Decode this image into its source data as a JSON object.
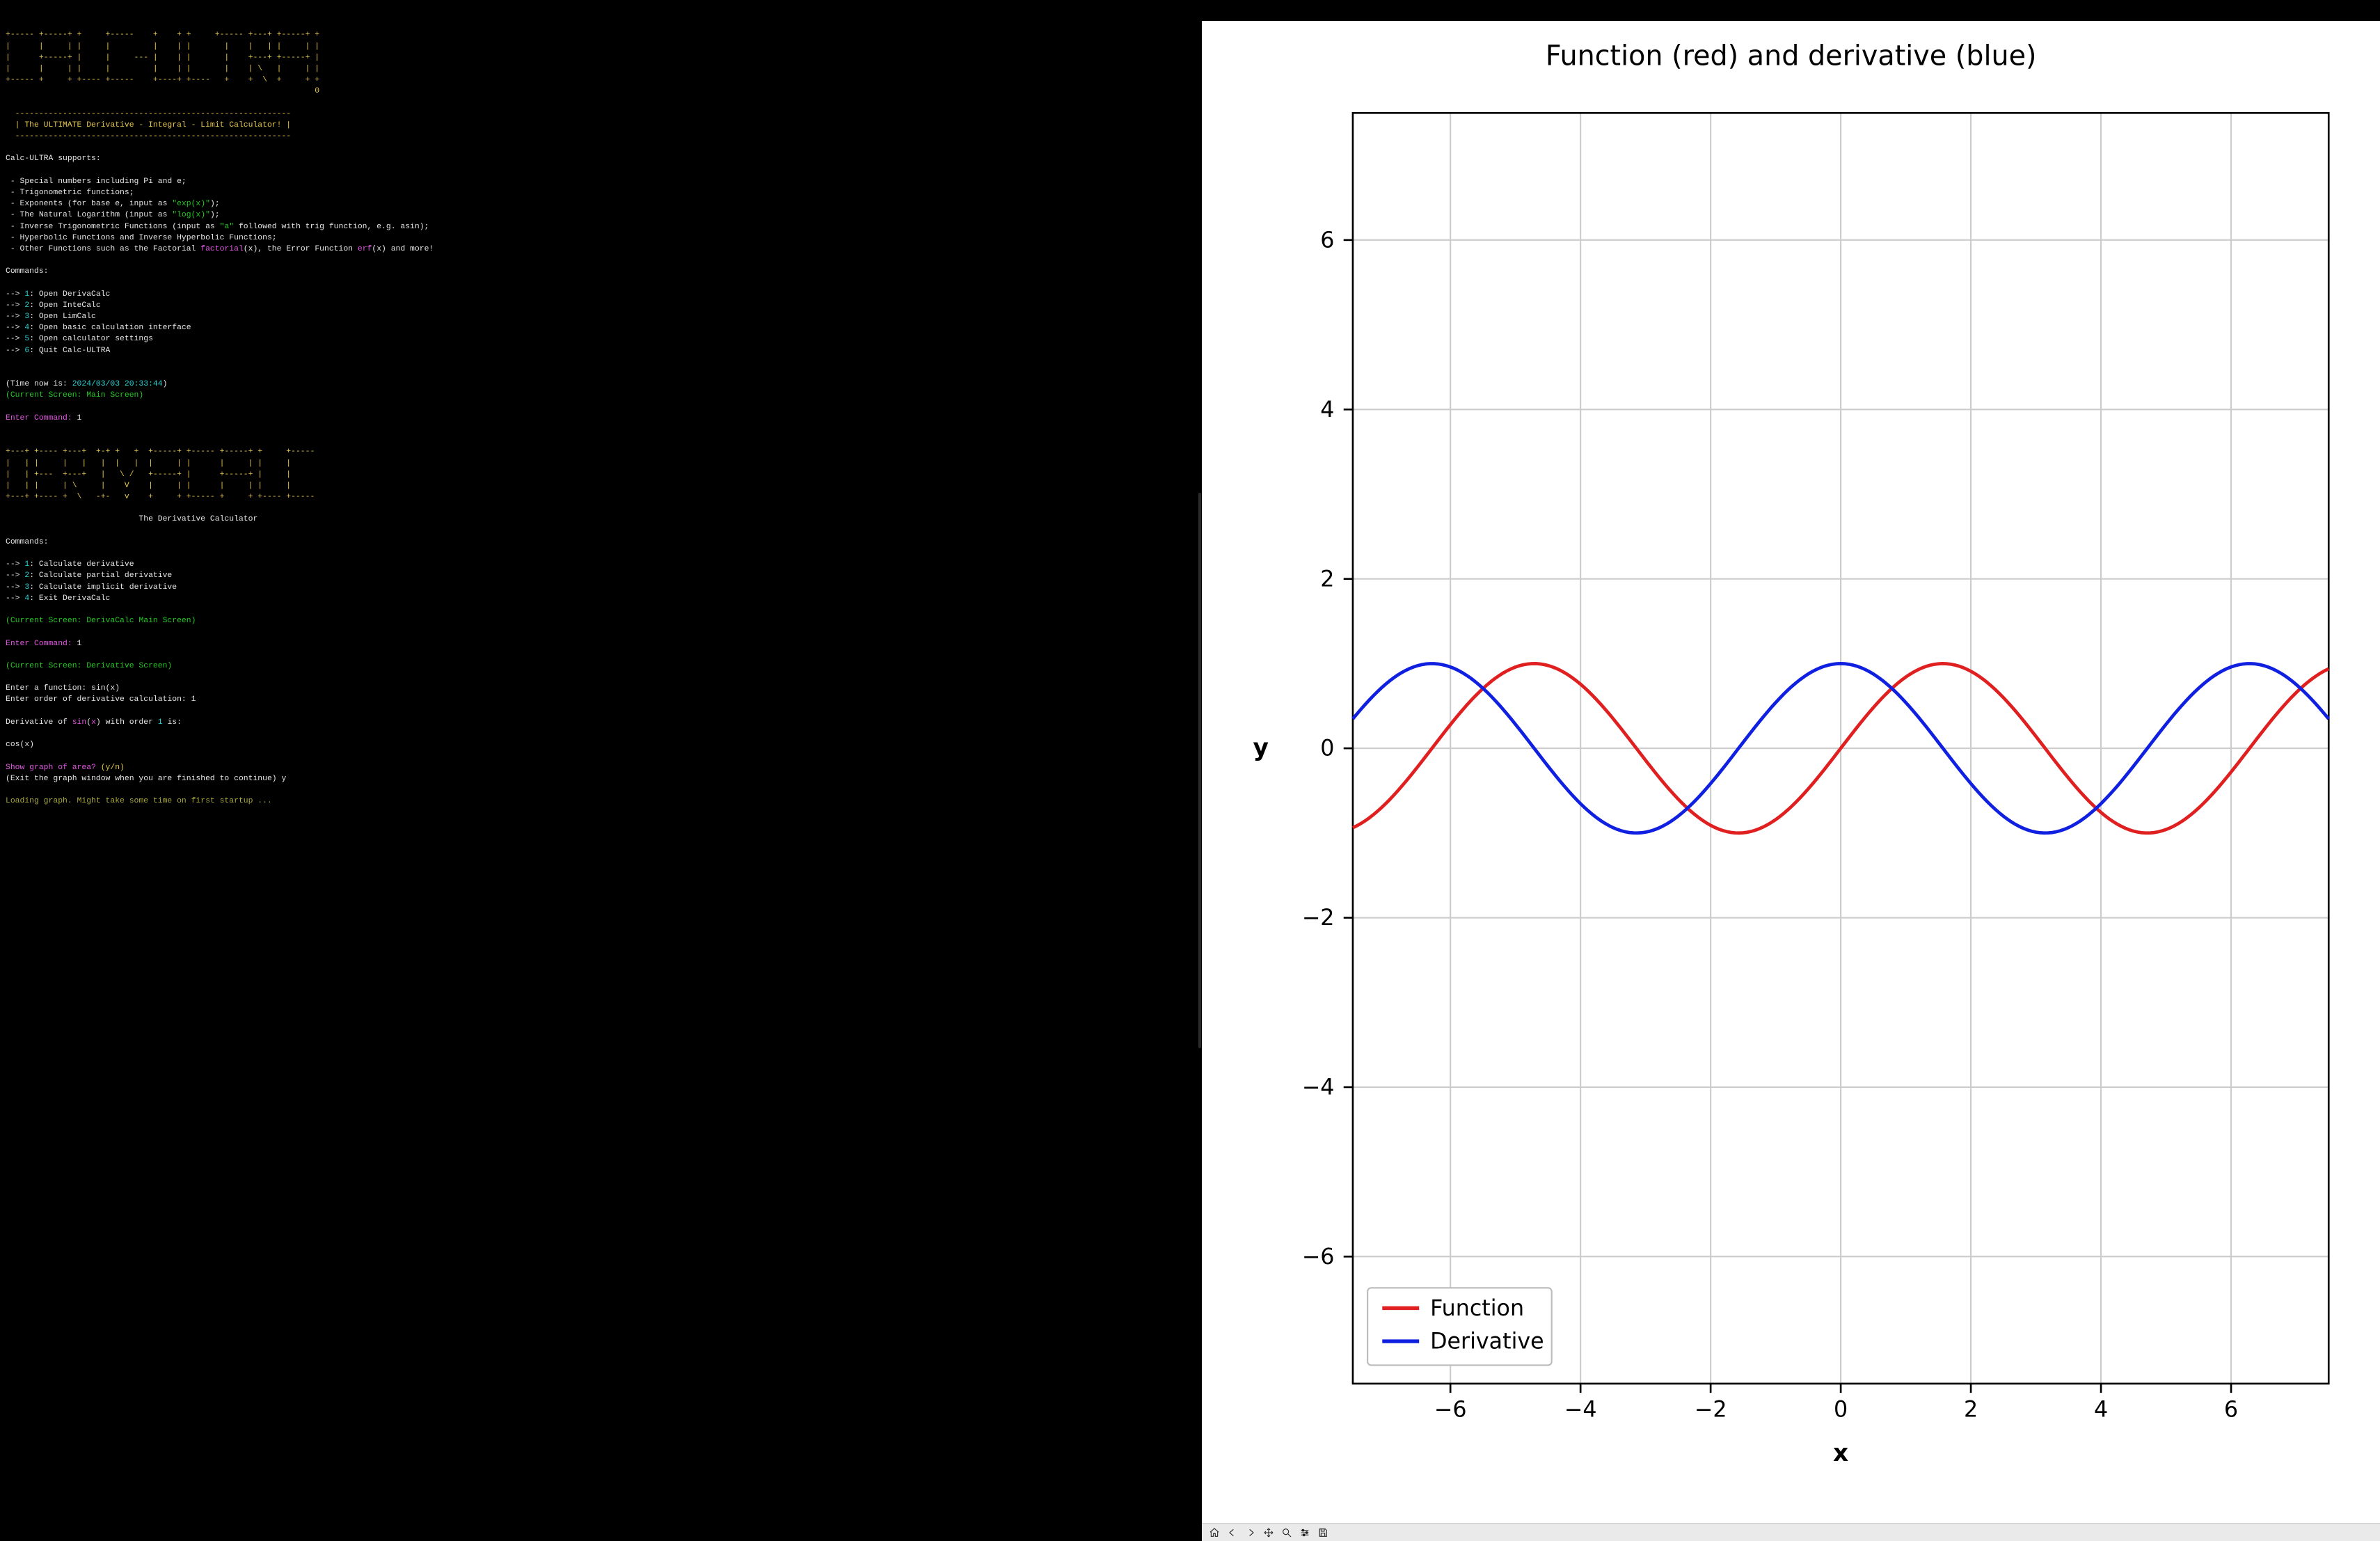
{
  "terminal": {
    "calc_ultra_banner": [
      "+----- +-----+ +     +-----    +    + +     +----- +---+ +-----+ +",
      "|      |     | |     |         |    | |       |    |   | |     | |",
      "|      +-----+ |     |     --- |    | |       |    +---+ +-----+ |",
      "|      |     | |     |         |    | |       |    | \\   |     | |",
      "+----- +     + +---- +-----    +----+ +----   +    +  \\  +     + +",
      "                                                                 0"
    ],
    "banner_divider_top": "  ----------------------------------------------------------",
    "banner_tagline": "  | The ULTIMATE Derivative - Integral - Limit Calculator! |",
    "banner_divider_bottom": "  ----------------------------------------------------------",
    "supports_heading": "Calc-ULTRA supports:",
    "supports": {
      "line1": " - Special numbers including Pi and e;",
      "line2": " - Trigonometric functions;",
      "line3_a": " - Exponents (for base e, input as ",
      "line3_b": "\"exp(x)\"",
      "line3_c": ");",
      "line4_a": " - The Natural Logarithm (input as ",
      "line4_b": "\"log(x)\"",
      "line4_c": ");",
      "line5_a": " - Inverse Trigonometric Functions (input as ",
      "line5_b": "\"a\"",
      "line5_c": " followed with trig function, e.g. asin);",
      "line6": " - Hyperbolic Functions and Inverse Hyperbolic Functions;",
      "line7_a": " - Other Functions such as the Factorial ",
      "line7_b": "factorial",
      "line7_c": "(x), the Error Function ",
      "line7_d": "erf",
      "line7_e": "(x) and more!"
    },
    "commands_heading": "Commands:",
    "commands": [
      {
        "num": "1",
        "label": "Open DerivaCalc"
      },
      {
        "num": "2",
        "label": "Open InteCalc"
      },
      {
        "num": "3",
        "label": "Open LimCalc"
      },
      {
        "num": "4",
        "label": "Open basic calculation interface"
      },
      {
        "num": "5",
        "label": "Open calculator settings"
      },
      {
        "num": "6",
        "label": "Quit Calc-ULTRA"
      }
    ],
    "time_prefix": "(Time now is: ",
    "time_value": "2024/03/03 20:33:44",
    "time_suffix": ")",
    "current_screen_main": "(Current Screen: Main Screen)",
    "enter_command_label": "Enter Command:",
    "enter_command_value_1": " 1",
    "derivacalc_banner": [
      "+---+ +---- +---+  +-+ +   +  +-----+ +----- +-----+ +     +-----",
      "|   | |     |   |   |  |   |  |     | |      |     | |     |     ",
      "|   | +---  +---+   |   \\ /   +-----+ |      +-----+ |     |     ",
      "|   | |     | \\     |    V    |     | |      |     | |     |     ",
      "+---+ +---- +  \\   -+-   v    +     + +----- +     + +---- +-----"
    ],
    "derivacalc_title": "                            The Derivative Calculator",
    "derivacalc_commands": [
      {
        "num": "1",
        "label": "Calculate derivative"
      },
      {
        "num": "2",
        "label": "Calculate partial derivative"
      },
      {
        "num": "3",
        "label": "Calculate implicit derivative"
      },
      {
        "num": "4",
        "label": "Exit DerivaCalc"
      }
    ],
    "current_screen_deriva": "(Current Screen: DerivaCalc Main Screen)",
    "enter_command_value_2": " 1",
    "current_screen_deriv": "(Current Screen: Derivative Screen)",
    "enter_func_label": "Enter a function: ",
    "enter_func_value": "sin(x)",
    "enter_order_label": "Enter order of derivative calculation: ",
    "enter_order_value": "1",
    "result_a": "Derivative of ",
    "result_b": "sin",
    "result_c": "(",
    "result_d": "x",
    "result_e": ") with order ",
    "result_f": "1",
    "result_g": " is:",
    "result_value": "cos(x)",
    "show_graph_label": "Show graph of area? ",
    "show_graph_hint": "(y/n)",
    "exit_hint": "(Exit the graph window when you are finished to continue) y",
    "loading_msg": "Loading graph. Might take some time on first startup ..."
  },
  "chart_data": {
    "type": "line",
    "title": "Function (red) and derivative (blue)",
    "xlabel": "x",
    "ylabel": "y",
    "xlim": [
      -7.5,
      7.5
    ],
    "ylim": [
      -7.5,
      7.5
    ],
    "xticks": [
      -6,
      -4,
      -2,
      0,
      2,
      4,
      6
    ],
    "yticks": [
      -6,
      -4,
      -2,
      0,
      2,
      4,
      6
    ],
    "legend": [
      "Function",
      "Derivative"
    ],
    "legend_colors": [
      "#e02020",
      "#1020e0"
    ],
    "legend_position": "lower-left",
    "series": [
      {
        "name": "Function",
        "color": "#e02020",
        "fn": "sin"
      },
      {
        "name": "Derivative",
        "color": "#1020e0",
        "fn": "cos"
      }
    ]
  },
  "toolbar_icons": {
    "home": "home-icon",
    "back": "back-icon",
    "forward": "forward-icon",
    "pan": "pan-icon",
    "zoom": "zoom-icon",
    "configure": "configure-icon",
    "save": "save-icon"
  }
}
